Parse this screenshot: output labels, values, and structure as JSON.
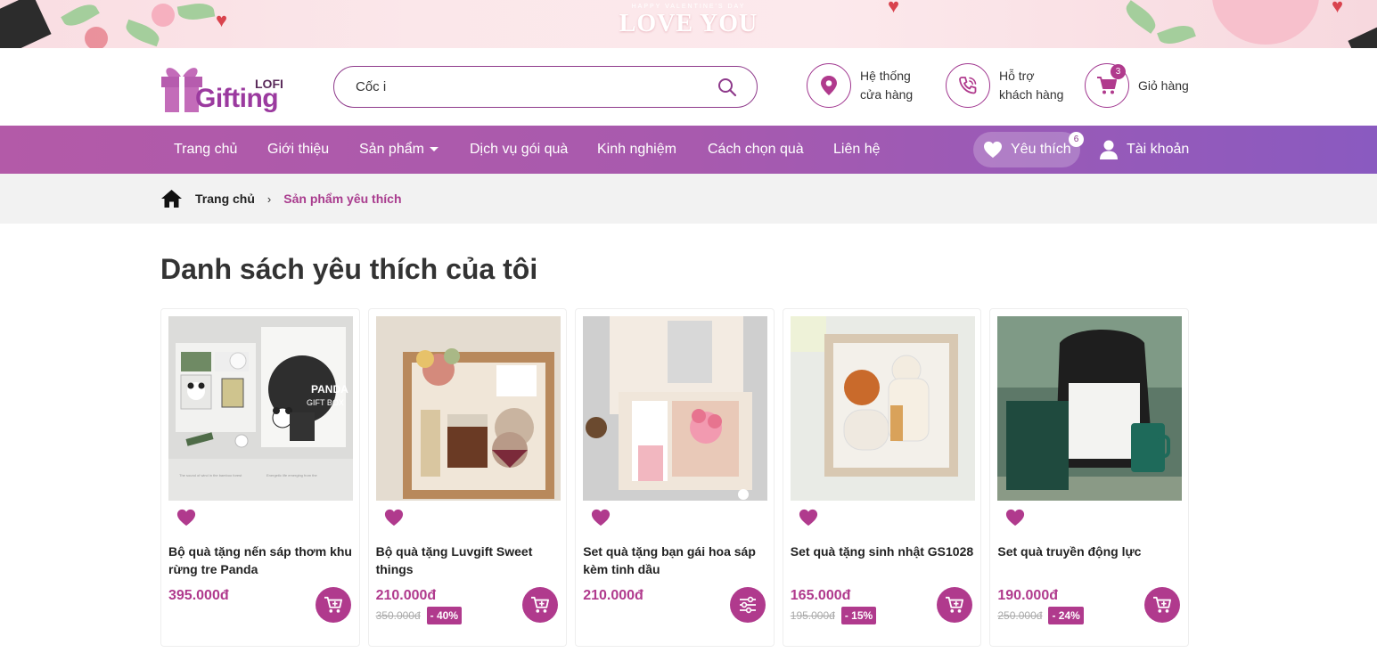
{
  "banner": {
    "subtitle": "HAPPY VALENTINE'S DAY",
    "title": "LOVE YOU"
  },
  "header": {
    "logo_top": "LOFI",
    "logo_main": "Gifting",
    "search": {
      "value": "Cốc i"
    },
    "store_system": {
      "line1": "Hệ thống",
      "line2": "cửa hàng"
    },
    "support": {
      "line1": "Hỗ trợ",
      "line2": "khách hàng"
    },
    "cart": {
      "label": "Giỏ hàng",
      "count": "3"
    }
  },
  "nav": {
    "items": [
      "Trang chủ",
      "Giới thiệu",
      "Sản phẩm",
      "Dịch vụ gói quà",
      "Kinh nghiệm",
      "Cách chọn quà",
      "Liên hệ"
    ],
    "wishlist": {
      "label": "Yêu thích",
      "count": "6"
    },
    "account": "Tài khoản"
  },
  "breadcrumb": {
    "home": "Trang chủ",
    "current": "Sản phẩm yêu thích"
  },
  "page_title": "Danh sách yêu thích của tôi",
  "products": [
    {
      "name": "Bộ quà tặng nến sáp thơm khu rừng tre Panda",
      "price": "395.000đ",
      "old_price": "",
      "discount": "",
      "action": "cart"
    },
    {
      "name": "Bộ quà tặng Luvgift Sweet things",
      "price": "210.000đ",
      "old_price": "350.000đ",
      "discount": "- 40%",
      "action": "cart"
    },
    {
      "name": "Set quà tặng bạn gái hoa sáp kèm tinh dầu",
      "price": "210.000đ",
      "old_price": "",
      "discount": "",
      "action": "options"
    },
    {
      "name": "Set quà tặng sinh nhật GS1028",
      "price": "165.000đ",
      "old_price": "195.000đ",
      "discount": "- 15%",
      "action": "cart"
    },
    {
      "name": "Set quà truyền động lực",
      "price": "190.000đ",
      "old_price": "250.000đ",
      "discount": "- 24%",
      "action": "cart"
    }
  ],
  "colors": {
    "brand": "#b03a8d",
    "nav_start": "#b35aa8",
    "nav_end": "#8a5ac0"
  }
}
